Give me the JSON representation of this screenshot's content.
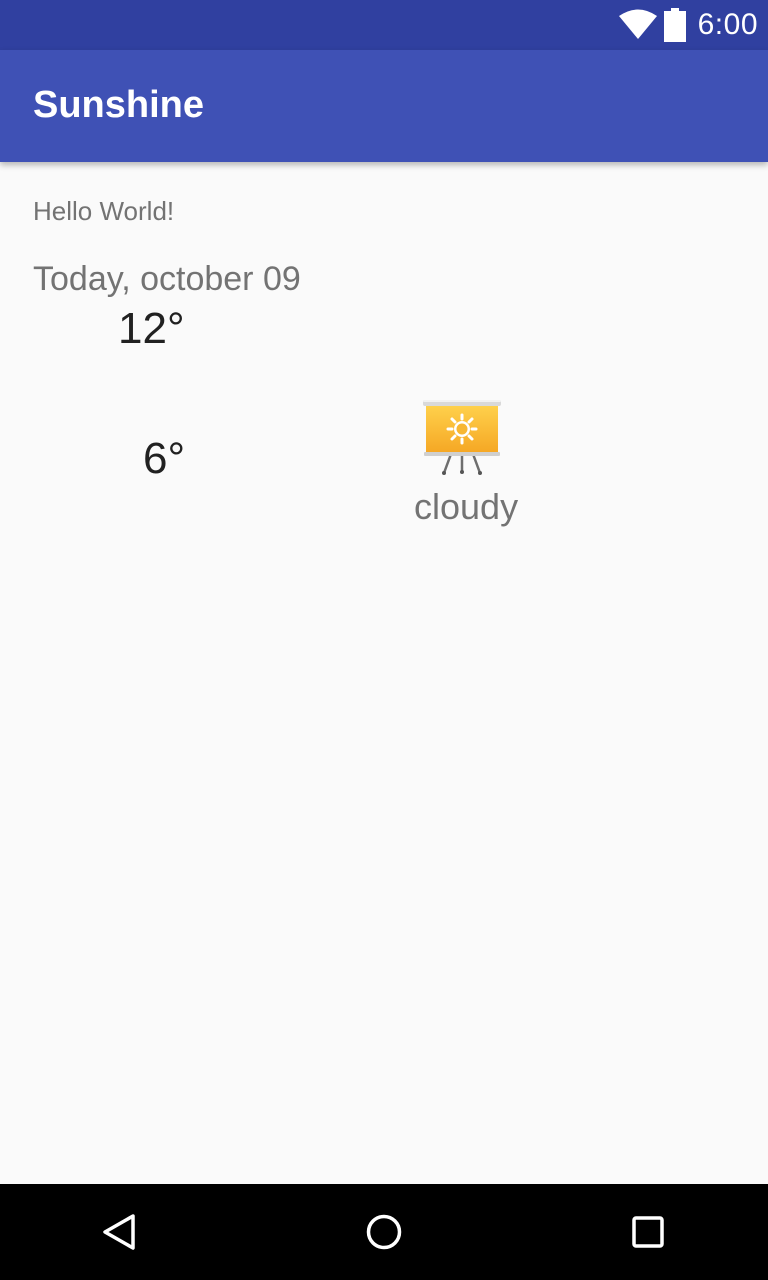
{
  "status_bar": {
    "time": "6:00",
    "icons": [
      "wifi-icon",
      "battery-icon"
    ]
  },
  "app_bar": {
    "title": "Sunshine"
  },
  "main": {
    "hello_text": "Hello World!",
    "date": "Today, october 09",
    "high": "12°",
    "low": "6°",
    "forecast": "cloudy",
    "weather_icon": "sun-icon"
  },
  "nav_bar": {
    "icons": [
      "back-icon",
      "home-icon",
      "recent-apps-icon"
    ]
  },
  "colors": {
    "status_bar": "#3040a0",
    "primary": "#3f51b5",
    "background": "#fafafa",
    "secondary_text": "#737373",
    "primary_text": "#212121"
  }
}
